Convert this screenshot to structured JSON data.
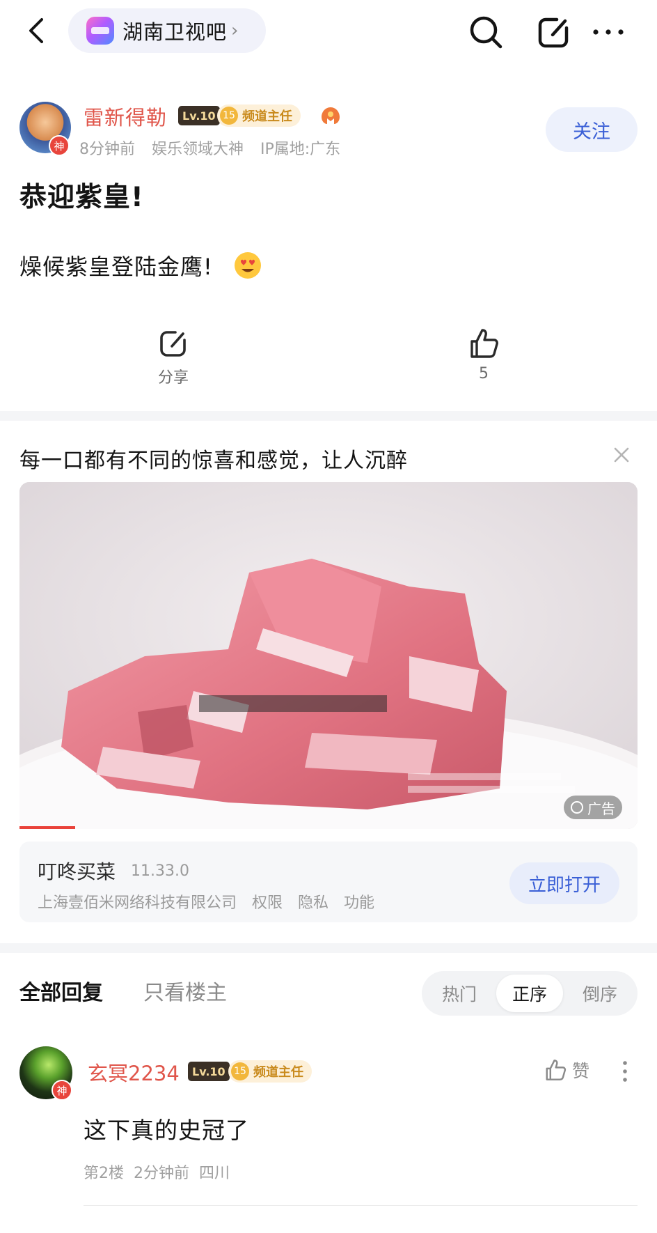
{
  "topbar": {
    "forum_name": "湖南卫视吧",
    "forum_chevron": "›"
  },
  "post": {
    "author": {
      "name": "雷新得勒",
      "level": "Lv.10",
      "role_level": "15",
      "role": "频道主任",
      "avatar_badge": "神",
      "time": "8分钟前",
      "title_tag": "娱乐领域大神",
      "ip": "IP属地:广东"
    },
    "follow_label": "关注",
    "title": "恭迎紫皇!",
    "body": "燥候紫皇登陆金鹰!",
    "actions": {
      "share_label": "分享",
      "like_count": "5"
    }
  },
  "ad": {
    "title": "每一口都有不同的惊喜和感觉，让人沉醉",
    "tag": "广告",
    "app_name": "叮咚买菜",
    "app_version": "11.33.0",
    "developer": "上海壹佰米网络科技有限公司",
    "links": [
      "权限",
      "隐私",
      "功能"
    ],
    "open_label": "立即打开"
  },
  "replies": {
    "tab_all": "全部回复",
    "tab_op": "只看楼主",
    "sort": [
      "热门",
      "正序",
      "倒序"
    ],
    "sort_active": "正序"
  },
  "comment": {
    "name": "玄冥2234",
    "level": "Lv.10",
    "role_level": "15",
    "role": "频道主任",
    "avatar_badge": "神",
    "like_label": "赞",
    "text": "这下真的史冠了",
    "floor": "第2楼",
    "time": "2分钟前",
    "location": "四川"
  },
  "colors": {
    "accent_blue": "#3a5fd6",
    "name_red": "#e0564b",
    "role_gold": "#c98a1c"
  }
}
